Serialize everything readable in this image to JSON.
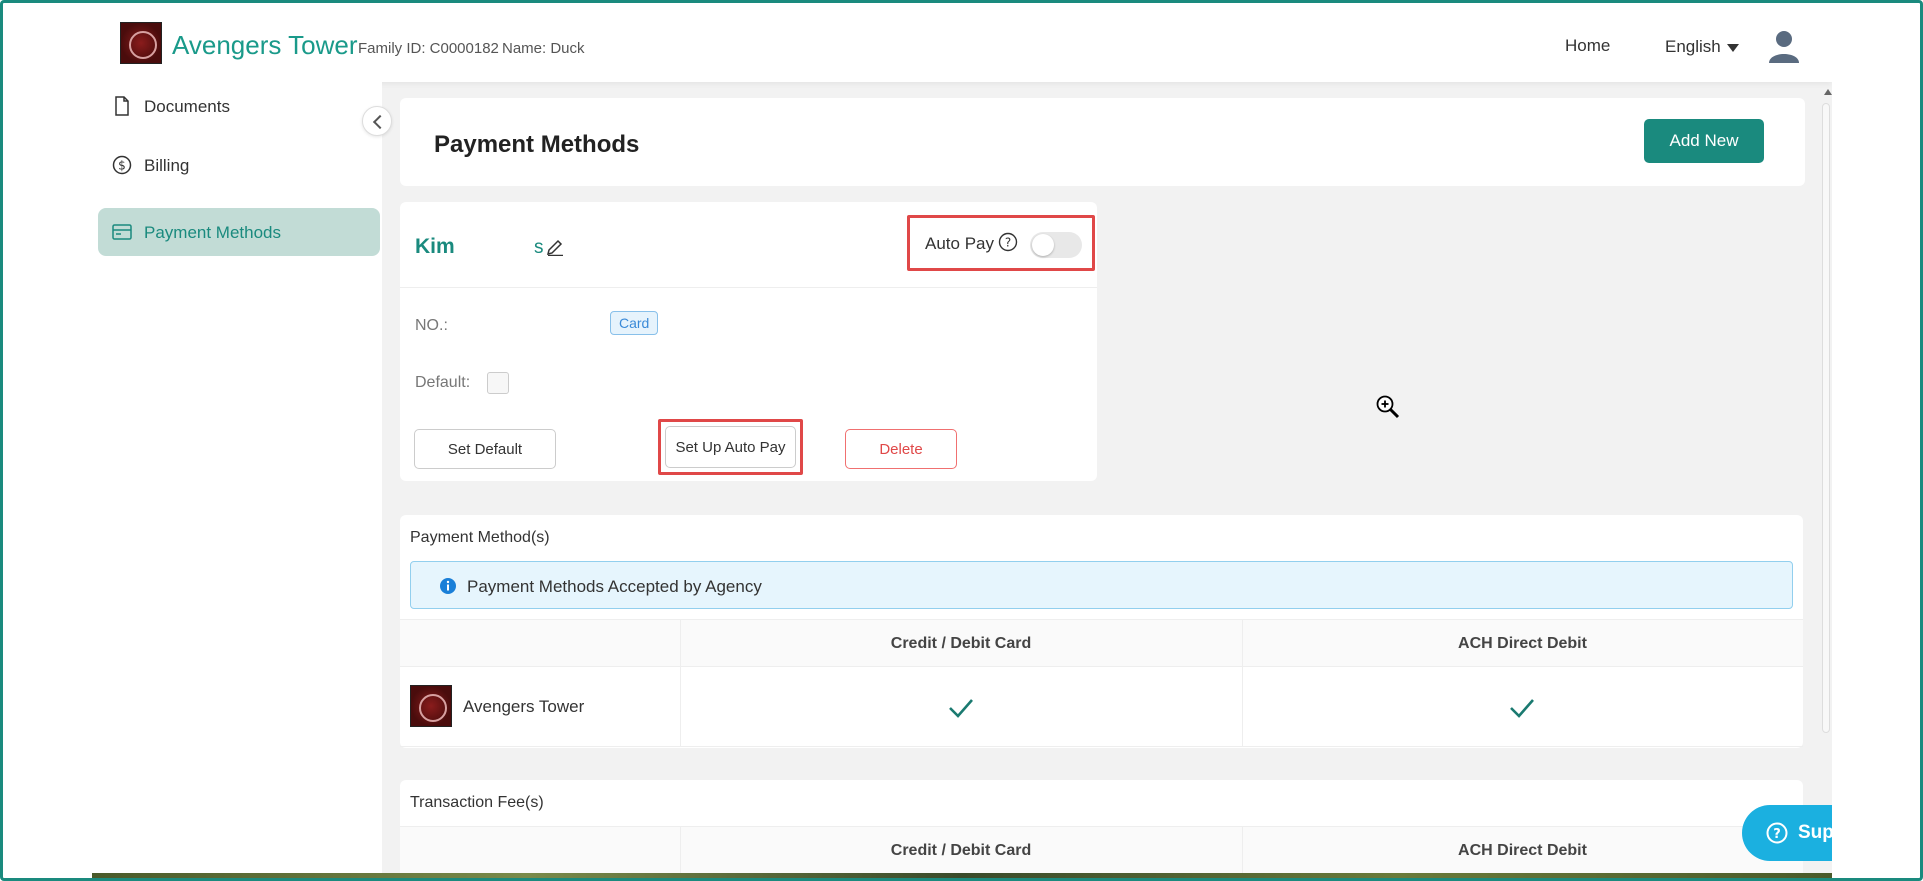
{
  "header": {
    "brand": "Avengers Tower",
    "family_id": "Family ID: C0000182",
    "family_name": "Name: Duck",
    "nav_home": "Home",
    "language": "English"
  },
  "sidebar": {
    "items": [
      {
        "label": "Documents",
        "icon": "document-icon"
      },
      {
        "label": "Billing",
        "icon": "dollar-circle-icon"
      },
      {
        "label": "Payment Methods",
        "icon": "credit-card-icon",
        "active": true
      }
    ]
  },
  "page": {
    "title": "Payment Methods",
    "add_new": "Add New"
  },
  "method_card": {
    "name": "Kim",
    "name_tail": "s",
    "auto_pay_label": "Auto Pay",
    "auto_pay_on": false,
    "no_label": "NO.:",
    "type_badge": "Card",
    "default_label": "Default:",
    "btn_set_default": "Set Default",
    "btn_set_auto_pay": "Set Up Auto Pay",
    "btn_delete": "Delete"
  },
  "payment_methods_section": {
    "title": "Payment Method(s)",
    "info": "Payment Methods Accepted by Agency",
    "columns": [
      "",
      "Credit / Debit Card",
      "ACH Direct Debit"
    ],
    "rows": [
      {
        "agency": "Avengers Tower",
        "credit_debit": true,
        "ach": true
      }
    ]
  },
  "transaction_fees_section": {
    "title": "Transaction Fee(s)",
    "columns": [
      "",
      "Credit / Debit Card",
      "ACH Direct Debit"
    ]
  },
  "support": {
    "label": "Support"
  },
  "colors": {
    "accent": "#1a8a7e",
    "highlight": "#e04848",
    "support": "#1bb0e0"
  }
}
